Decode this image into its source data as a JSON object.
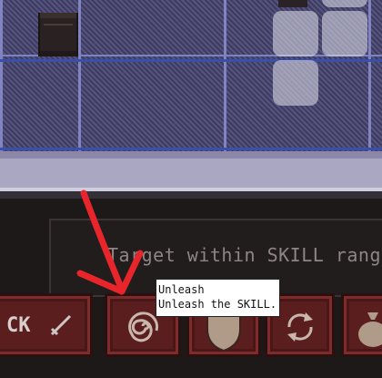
{
  "message": "Target within SKILL range",
  "tooltip": {
    "title": "Unleash",
    "description": "Unleash the SKILL."
  },
  "buttons": {
    "attack_label": "CK"
  },
  "icons": {
    "attack": "sword-icon",
    "unleash": "spiral-icon",
    "block": "shield-icon",
    "swap": "cycle-arrows-icon",
    "bag": "bag-icon"
  },
  "colors": {
    "button_fill": "#5a1e1f",
    "annotation_arrow": "#e8252a",
    "ghost_tile": "#e1e1eb"
  }
}
